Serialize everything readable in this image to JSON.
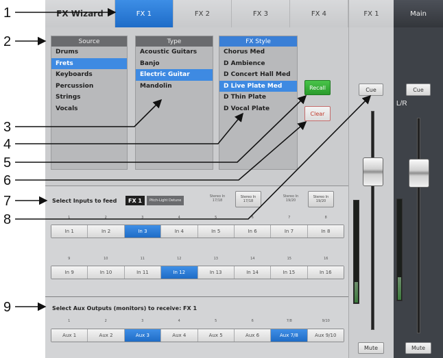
{
  "callouts": [
    "1",
    "2",
    "3",
    "4",
    "5",
    "6",
    "7",
    "8",
    "9"
  ],
  "tabs": [
    {
      "label": "FX Wizard",
      "active": false
    },
    {
      "label": "FX 1",
      "active": true
    },
    {
      "label": "FX 2",
      "active": false
    },
    {
      "label": "FX 3",
      "active": false
    },
    {
      "label": "FX 4",
      "active": false
    }
  ],
  "fx1_strip": {
    "title": "FX 1",
    "cue": "Cue",
    "mute": "Mute",
    "meter_level": 0.2
  },
  "main_strip": {
    "title": "Main",
    "cue": "Cue",
    "label": "L/R",
    "mute": "Mute",
    "meter_level": 0.22
  },
  "wizard": {
    "source": {
      "header": "Source",
      "items": [
        "Drums",
        "Frets",
        "Keyboards",
        "Percussion",
        "Strings",
        "Vocals"
      ],
      "selected": 1
    },
    "type": {
      "header": "Type",
      "items": [
        "Acoustic Guitars",
        "Banjo",
        "Electric Guitar",
        "Mandolin"
      ],
      "selected": 2
    },
    "fx_style": {
      "header": "FX Style",
      "items": [
        "Chorus Med",
        "D Ambience",
        "D Concert Hall Med",
        "D Live Plate Med",
        "D Thin Plate",
        "D Vocal Plate"
      ],
      "selected": 3
    },
    "recall": "Recall",
    "clear": "Clear"
  },
  "inputs": {
    "label": "Select Inputs to feed",
    "fx_tag": "FX 1",
    "fx_name": "Pitch-Light Detune",
    "stereo": [
      {
        "caption": "Stereo In 17/18",
        "button": "Stereo In 17/18"
      },
      {
        "caption": "Stereo In 19/20",
        "button": "Stereo In 19/20"
      }
    ],
    "row1": {
      "nums": [
        "1",
        "2",
        "3",
        "4",
        "5",
        "6",
        "7",
        "8"
      ],
      "labels": [
        "In 1",
        "In 2",
        "In 3",
        "In 4",
        "In 5",
        "In 6",
        "In 7",
        "In 8"
      ],
      "on": [
        2
      ]
    },
    "row2": {
      "nums": [
        "9",
        "10",
        "11",
        "12",
        "13",
        "14",
        "15",
        "16"
      ],
      "labels": [
        "In 9",
        "In 10",
        "In 11",
        "In 12",
        "In 13",
        "In 14",
        "In 15",
        "In 16"
      ],
      "on": [
        3
      ]
    }
  },
  "aux": {
    "label": "Select Aux Outputs (monitors) to receive: FX 1",
    "nums": [
      "1",
      "2",
      "3",
      "4",
      "5",
      "6",
      "7/8",
      "9/10"
    ],
    "labels": [
      "Aux 1",
      "Aux 2",
      "Aux 3",
      "Aux 4",
      "Aux 5",
      "Aux 6",
      "Aux 7/8",
      "Aux 9/10"
    ],
    "on": [
      2,
      6
    ]
  },
  "colors": {
    "accent": "#1e6cc8",
    "recall_green": "#2a9b2c",
    "clear_red": "#c0392b"
  }
}
